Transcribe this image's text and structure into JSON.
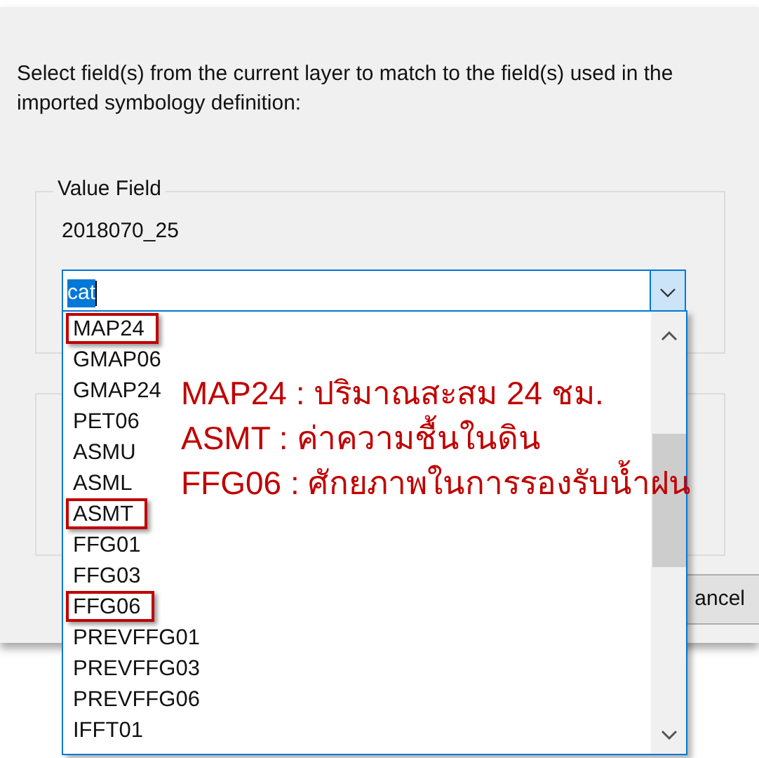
{
  "instruction": "Select field(s) from the current layer to match to the field(s) used in the imported symbology definition:",
  "value_field": {
    "label": "Value Field",
    "value": "2018070_25",
    "combo_value": "cat"
  },
  "cancel_button": {
    "label": "ancel"
  },
  "dropdown": {
    "items": [
      {
        "label": "MAP24",
        "marked": true
      },
      {
        "label": "GMAP06",
        "marked": false
      },
      {
        "label": "GMAP24",
        "marked": false
      },
      {
        "label": "PET06",
        "marked": false
      },
      {
        "label": "ASMU",
        "marked": false
      },
      {
        "label": "ASML",
        "marked": false
      },
      {
        "label": "ASMT",
        "marked": true
      },
      {
        "label": "FFG01",
        "marked": false
      },
      {
        "label": "FFG03",
        "marked": false
      },
      {
        "label": "FFG06",
        "marked": true
      },
      {
        "label": "PREVFFG01",
        "marked": false
      },
      {
        "label": "PREVFFG03",
        "marked": false
      },
      {
        "label": "PREVFFG06",
        "marked": false
      },
      {
        "label": "IFFT01",
        "marked": false
      }
    ]
  },
  "annotations": [
    "MAP24 : ปริมาณสะสม 24 ชม.",
    "ASMT : ค่าความชื้นในดิน",
    "FFG06 : ศักยภาพในการรองรับน้ำฝน"
  ]
}
